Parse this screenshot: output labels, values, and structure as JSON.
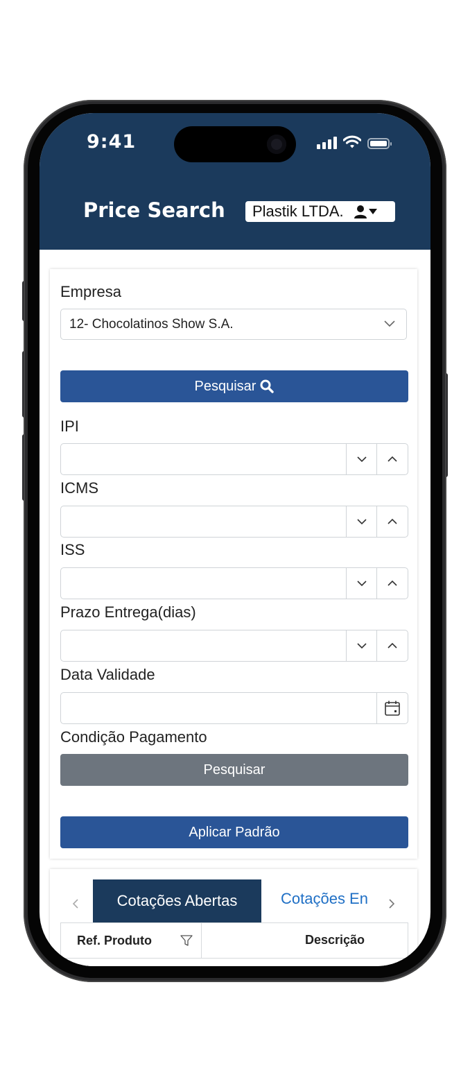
{
  "status_bar": {
    "time": "9:41"
  },
  "header": {
    "title": "Price Search",
    "company_label": "Plastik LTDA."
  },
  "form": {
    "empresa_label": "Empresa",
    "empresa_value": "12- Chocolatinos Show S.A.",
    "search_button": "Pesquisar",
    "ipi_label": "IPI",
    "icms_label": "ICMS",
    "iss_label": "ISS",
    "prazo_label": "Prazo Entrega(dias)",
    "data_validade_label": "Data Validade",
    "condicao_label": "Condição Pagamento",
    "condicao_button": "Pesquisar",
    "apply_button": "Aplicar Padrão"
  },
  "tabs": {
    "active": "Cotações Abertas",
    "next": "Cotações En"
  },
  "table": {
    "columns": [
      "Ref. Produto",
      "Descrição"
    ]
  },
  "colors": {
    "header_bg": "#1b3a5c",
    "primary_button": "#2a5597",
    "secondary_button": "#6d757e",
    "tab_link": "#1f6fc5"
  }
}
